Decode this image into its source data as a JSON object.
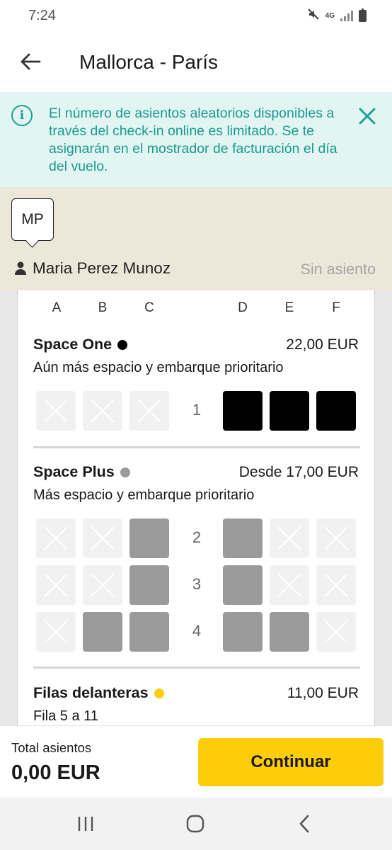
{
  "status_bar": {
    "time": "7:24",
    "network": "4G"
  },
  "header": {
    "title": "Mallorca - París"
  },
  "banner": {
    "text": "El número de asientos aleatorios disponibles a través del check-in online es limitado. Se te asignarán en el mostrador de facturación el día del vuelo."
  },
  "passenger": {
    "initials": "MP",
    "name": "Maria Perez Munoz",
    "seat_status": "Sin asiento"
  },
  "seat_map": {
    "columns": [
      "A",
      "B",
      "C",
      "D",
      "E",
      "F"
    ],
    "classes": [
      {
        "title": "Space One",
        "dot_color": "#000000",
        "price": "22,00 EUR",
        "description": "Aún más espacio y embarque prioritario",
        "rows": [
          {
            "number": "1",
            "seats": [
              "unavailable",
              "unavailable",
              "unavailable",
              "black",
              "black",
              "black"
            ]
          }
        ]
      },
      {
        "title": "Space Plus",
        "dot_color": "#9b9b9b",
        "price": "Desde 17,00 EUR",
        "description": "Más espacio y embarque prioritario",
        "rows": [
          {
            "number": "2",
            "seats": [
              "unavailable",
              "unavailable",
              "grey",
              "grey",
              "unavailable",
              "unavailable"
            ]
          },
          {
            "number": "3",
            "seats": [
              "unavailable",
              "unavailable",
              "grey",
              "grey",
              "unavailable",
              "unavailable"
            ]
          },
          {
            "number": "4",
            "seats": [
              "unavailable",
              "grey",
              "grey",
              "grey",
              "grey",
              "unavailable"
            ]
          }
        ]
      },
      {
        "title": "Filas delanteras",
        "dot_color": "#fdcd0a",
        "price": "11,00 EUR",
        "description": "Fila 5 a 11"
      }
    ]
  },
  "footer": {
    "total_label": "Total asientos",
    "total_value": "0,00 EUR",
    "continue_label": "Continuar"
  },
  "colors": {
    "accent": "#fdcd0a",
    "info": "#1a9a8f",
    "banner_bg": "#e2f5f3",
    "passenger_bg": "#ede7da"
  }
}
